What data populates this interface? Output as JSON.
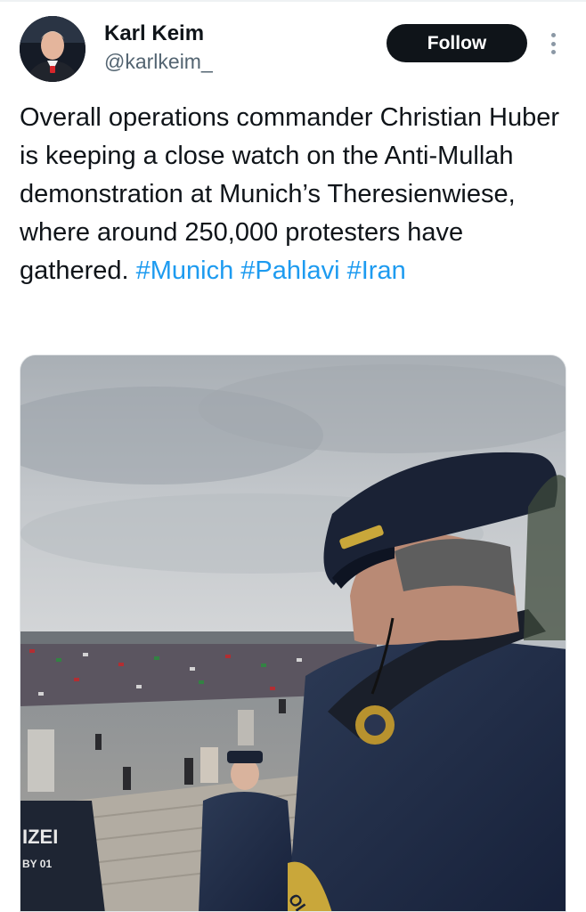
{
  "tweet": {
    "author": {
      "display_name": "Karl Keim",
      "handle": "@karlkeim_",
      "avatar_icon": "person-avatar-icon"
    },
    "follow_label": "Follow",
    "more_icon": "more-vertical-icon",
    "text": "Overall operations commander Christian Huber is keeping a close watch on the Anti-Mullah demonstration at Munich’s Theresienwiese, where around 250,000 protesters have gathered.",
    "hashtags": [
      "#Munich",
      "#Pahlavi",
      "#Iran"
    ],
    "media": {
      "type": "photo",
      "patch_text_left": "IZEI",
      "patch_text_left_small": "BY 01",
      "patch_text_right": "OLIZEI"
    },
    "colors": {
      "link": "#1d9bf0",
      "text": "#0f1419",
      "secondary": "#536471",
      "button": "#0f1419"
    }
  }
}
